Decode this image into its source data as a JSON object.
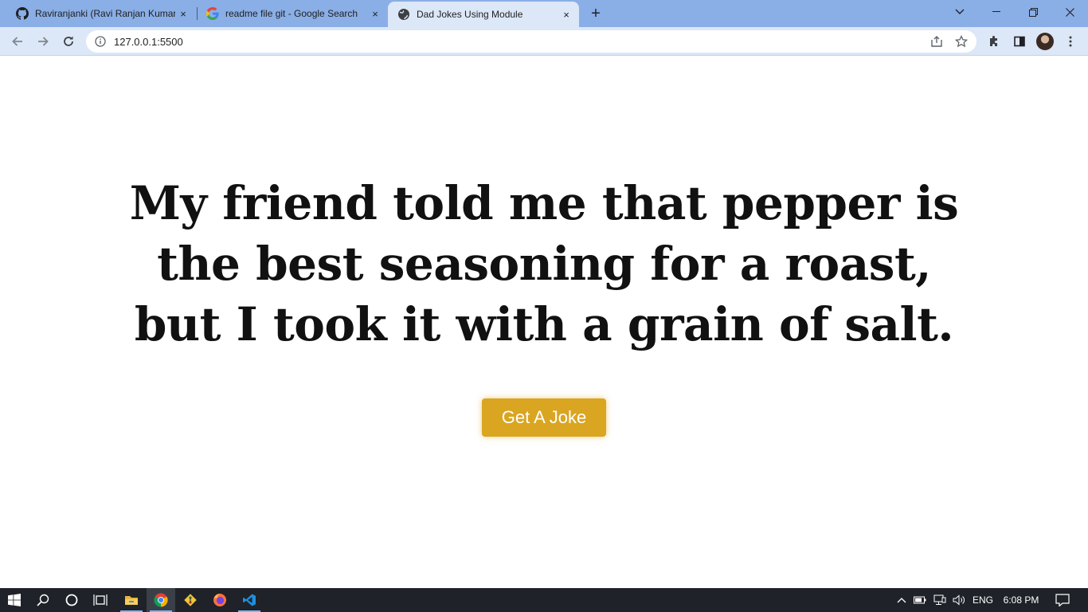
{
  "browser": {
    "tabs": [
      {
        "title": "Raviranjanki (Ravi Ranjan Kumar)",
        "icon": "github-icon",
        "close": "×"
      },
      {
        "title": "readme file git - Google Search",
        "icon": "google-icon",
        "close": "×"
      },
      {
        "title": "Dad Jokes Using Module",
        "icon": "globe-icon",
        "close": "×",
        "active": true
      }
    ],
    "new_tab": "+",
    "url": "127.0.0.1:5500"
  },
  "page": {
    "joke_text": "My friend told me that pepper is the best seasoning for a roast, but I took it with a grain of salt.",
    "button_label": "Get A Joke",
    "button_color": "#daa520"
  },
  "taskbar": {
    "apps": [
      "windows-start-icon",
      "search-icon",
      "cortana-icon",
      "task-view-icon",
      "file-explorer-icon",
      "chrome-icon",
      "git-icon",
      "firefox-icon",
      "vscode-icon"
    ],
    "language": "ENG",
    "time": "6:08 PM"
  }
}
